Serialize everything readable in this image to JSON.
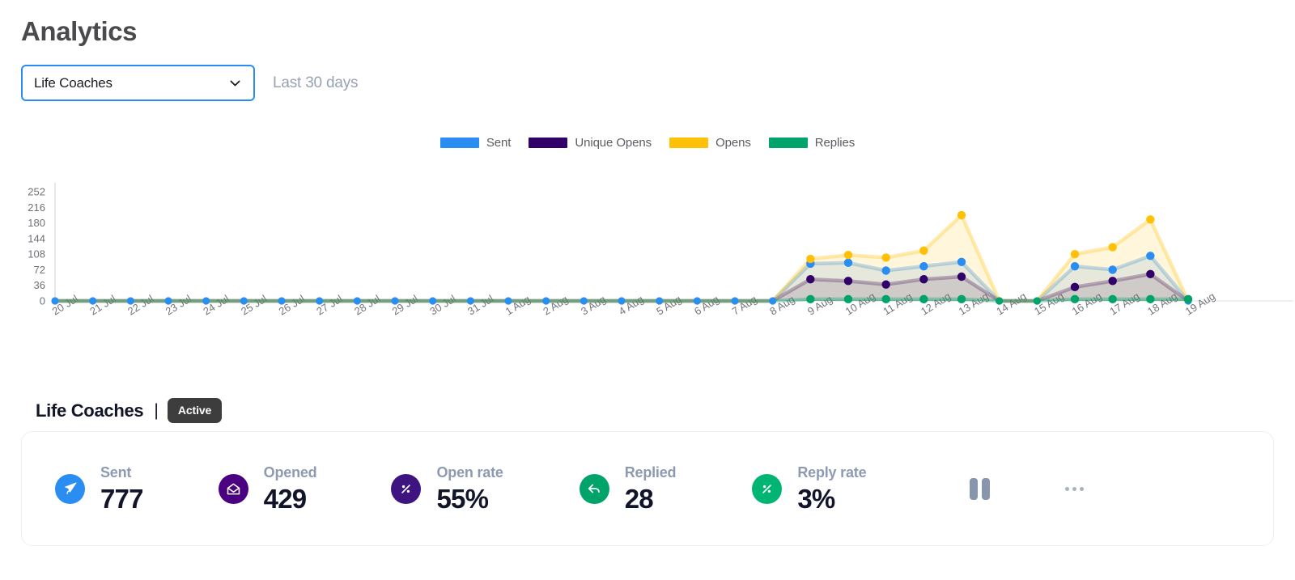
{
  "header": {
    "title": "Analytics",
    "campaign_filter": {
      "selected": "Life Coaches",
      "chevron": "chevron-down-icon"
    },
    "date_range": "Last 30 days"
  },
  "chart_data": {
    "type": "line",
    "title": "",
    "xlabel": "",
    "ylabel": "",
    "grid": false,
    "legend_position": "top-center",
    "ylim": [
      0,
      252
    ],
    "y_ticks": [
      0,
      36,
      72,
      108,
      144,
      180,
      216,
      252
    ],
    "categories": [
      "20 Jul",
      "21 Jul",
      "22 Jul",
      "23 Jul",
      "24 Jul",
      "25 Jul",
      "26 Jul",
      "27 Jul",
      "28 Jul",
      "29 Jul",
      "30 Jul",
      "31 Jul",
      "1 Aug",
      "2 Aug",
      "3 Aug",
      "4 Aug",
      "5 Aug",
      "6 Aug",
      "7 Aug",
      "8 Aug",
      "9 Aug",
      "10 Aug",
      "11 Aug",
      "12 Aug",
      "13 Aug",
      "14 Aug",
      "15 Aug",
      "16 Aug",
      "17 Aug",
      "18 Aug",
      "19 Aug"
    ],
    "series": [
      {
        "name": "Sent",
        "color": "#2a8df2",
        "values": [
          0,
          0,
          0,
          0,
          0,
          0,
          0,
          0,
          0,
          0,
          0,
          0,
          0,
          0,
          0,
          0,
          0,
          0,
          0,
          0,
          86,
          88,
          70,
          80,
          90,
          0,
          0,
          80,
          72,
          104,
          0
        ]
      },
      {
        "name": "Unique Opens",
        "color": "#310069",
        "values": [
          0,
          0,
          0,
          0,
          0,
          0,
          0,
          0,
          0,
          0,
          0,
          0,
          0,
          0,
          0,
          0,
          0,
          0,
          0,
          0,
          50,
          46,
          38,
          50,
          56,
          0,
          0,
          32,
          46,
          62,
          0
        ]
      },
      {
        "name": "Opens",
        "color": "#ffc107",
        "values": [
          0,
          0,
          0,
          0,
          0,
          0,
          0,
          0,
          0,
          0,
          0,
          0,
          0,
          0,
          0,
          0,
          0,
          0,
          0,
          0,
          97,
          106,
          100,
          116,
          198,
          0,
          0,
          108,
          124,
          188,
          0
        ]
      },
      {
        "name": "Replies",
        "color": "#00a36a",
        "values": [
          0,
          0,
          0,
          0,
          0,
          0,
          0,
          0,
          0,
          0,
          0,
          0,
          0,
          0,
          0,
          0,
          0,
          0,
          0,
          0,
          4,
          4,
          4,
          4,
          4,
          0,
          0,
          4,
          4,
          4,
          4
        ]
      }
    ]
  },
  "campaign": {
    "name": "Life Coaches",
    "separator": "|",
    "status": "Active"
  },
  "stats": [
    {
      "label": "Sent",
      "value": "777",
      "icon": "paper-plane-icon",
      "icon_color": "#2a8df2",
      "slug": "sent"
    },
    {
      "label": "Opened",
      "value": "429",
      "icon": "open-envelope-icon",
      "icon_color": "#4b0082",
      "slug": "opened"
    },
    {
      "label": "Open rate",
      "value": "55%",
      "icon": "percent-icon",
      "icon_color": "#3d1480",
      "slug": "open-rate"
    },
    {
      "label": "Replied",
      "value": "28",
      "icon": "reply-arrow-icon",
      "icon_color": "#00a36a",
      "slug": "replied"
    },
    {
      "label": "Reply rate",
      "value": "3%",
      "icon": "percent-icon",
      "icon_color": "#00b574",
      "slug": "reply-rate"
    }
  ],
  "actions": {
    "pause": "pause-icon",
    "more": "ellipsis-icon"
  }
}
